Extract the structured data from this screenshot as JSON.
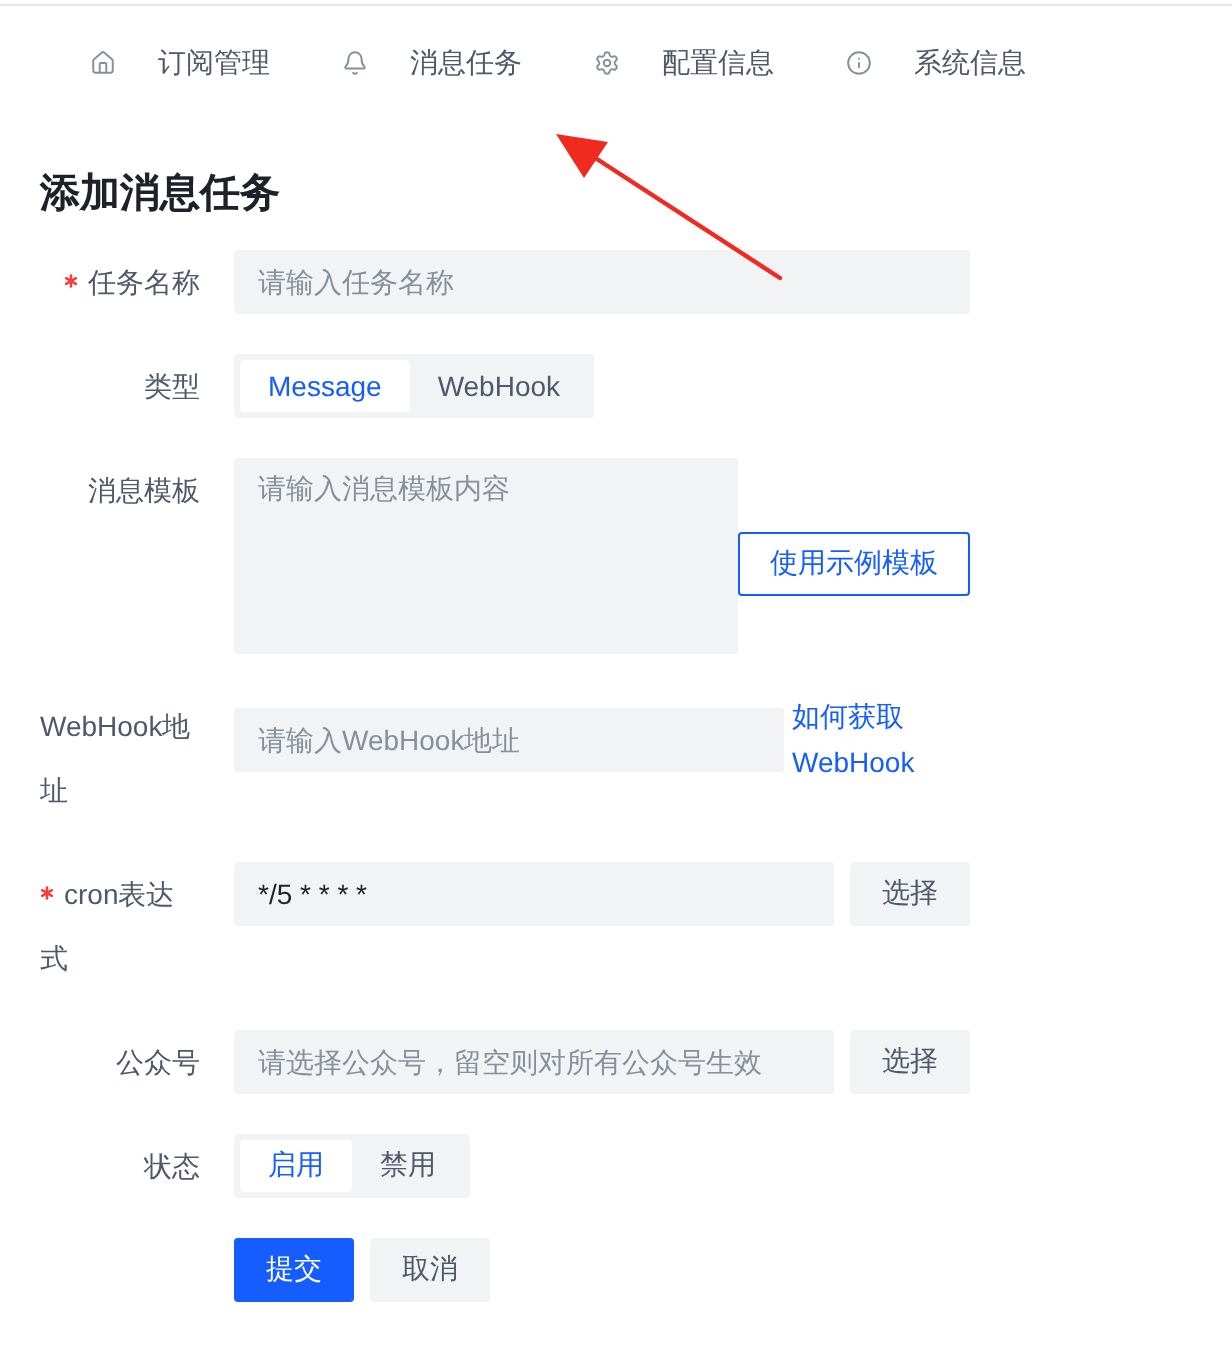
{
  "nav": {
    "items": [
      {
        "label": "订阅管理"
      },
      {
        "label": "消息任务"
      },
      {
        "label": "配置信息"
      },
      {
        "label": "系统信息"
      }
    ]
  },
  "form": {
    "title": "添加消息任务",
    "fields": [
      {
        "kind": "input",
        "label": "任务名称",
        "required": true,
        "placeholder": "请输入任务名称"
      },
      {
        "kind": "segmented",
        "label": "类型",
        "required": false,
        "options": [
          {
            "label": "Message",
            "selected": true
          },
          {
            "label": "WebHook",
            "selected": false
          }
        ]
      },
      {
        "kind": "textarea",
        "label": "消息模板",
        "required": false,
        "placeholder": "请输入消息模板内容",
        "button": "使用示例模板"
      },
      {
        "kind": "input",
        "label": "WebHook地址",
        "required": false,
        "placeholder": "请输入WebHook地址",
        "link": "如何获取WebHook"
      },
      {
        "kind": "input",
        "label": "cron表达式",
        "required": true,
        "value": "*/5 * * * *",
        "button": "选择"
      },
      {
        "kind": "input",
        "label": "公众号",
        "required": false,
        "placeholder": "请选择公众号，留空则对所有公众号生效",
        "button": "选择"
      },
      {
        "kind": "segmented",
        "label": "状态",
        "required": false,
        "options": [
          {
            "label": "启用",
            "selected": true
          },
          {
            "label": "禁用",
            "selected": false
          }
        ]
      }
    ],
    "actions": [
      {
        "label": "提交",
        "kind": "primary"
      },
      {
        "label": "取消",
        "kind": "secondary"
      }
    ]
  }
}
